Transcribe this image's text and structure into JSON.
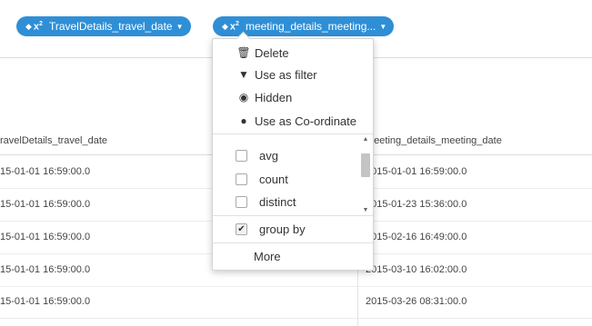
{
  "chips": [
    {
      "label": "TravelDetails_travel_date",
      "sort_glyph": "◆",
      "fx_glyph": "x",
      "fx_sup": "2",
      "caret": "▼"
    },
    {
      "label": "meeting_details_meeting...",
      "sort_glyph": "◆",
      "fx_glyph": "x",
      "fx_sup": "2",
      "caret": "▼"
    }
  ],
  "table": {
    "headers": [
      "ravelDetails_travel_date",
      "meeting_details_meeting_date"
    ],
    "rows": [
      [
        "15-01-01 16:59:00.0",
        "2015-01-01 16:59:00.0"
      ],
      [
        "15-01-01 16:59:00.0",
        "2015-01-23 15:36:00.0"
      ],
      [
        "15-01-01 16:59:00.0",
        "2015-02-16 16:49:00.0"
      ],
      [
        "15-01-01 16:59:00.0",
        "2015-03-10 16:02:00.0"
      ],
      [
        "15-01-01 16:59:00.0",
        "2015-03-26 08:31:00.0"
      ]
    ]
  },
  "dropdown": {
    "actions": [
      {
        "label": "Delete",
        "icon": "trash-icon",
        "glyph": "🗑"
      },
      {
        "label": "Use as filter",
        "icon": "filter-icon",
        "glyph": "▼"
      },
      {
        "label": "Hidden",
        "icon": "eye-slash-icon",
        "glyph": "◉"
      },
      {
        "label": "Use as Co-ordinate",
        "icon": "globe-icon",
        "glyph": "●"
      }
    ],
    "aggregations": [
      {
        "label": "avg",
        "checked": false
      },
      {
        "label": "count",
        "checked": false
      },
      {
        "label": "distinct",
        "checked": false
      }
    ],
    "group_by": {
      "label": "group by",
      "checked": true,
      "check_glyph": "✔"
    },
    "more_label": "More",
    "scroll_up": "▲",
    "scroll_down": "▼"
  },
  "colors": {
    "chip_bg": "#2f8fd6",
    "chip_text": "#ffffff"
  }
}
